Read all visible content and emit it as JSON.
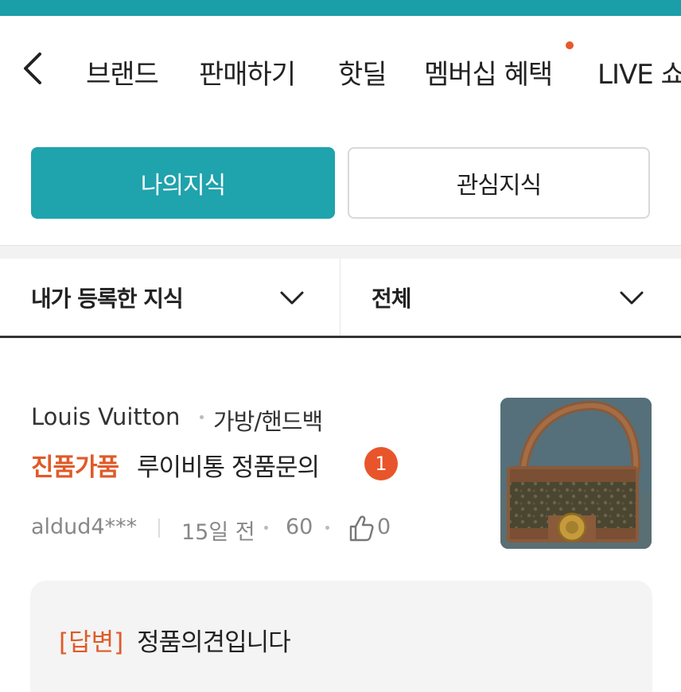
{
  "nav": {
    "items": [
      "브랜드",
      "판매하기",
      "핫딜",
      "멤버십 혜택",
      "LIVE 쇼"
    ]
  },
  "tabs": {
    "mine": "나의지식",
    "favorite": "관심지식"
  },
  "filters": {
    "left": "내가 등록한 지식",
    "right": "전체"
  },
  "post": {
    "brand": "Louis Vuitton",
    "category": "가방/핸드백",
    "tag": "진품가품",
    "title": "루이비통 정품문의",
    "answer_count": "1",
    "author": "aldud4***",
    "time": "15일 전",
    "views": "60",
    "likes": "0"
  },
  "answer": {
    "tag": "[답변]",
    "text": "정품의견입니다"
  },
  "colors": {
    "accent": "#1fa3ac",
    "highlight": "#e05a28",
    "badge": "#e8552a"
  }
}
